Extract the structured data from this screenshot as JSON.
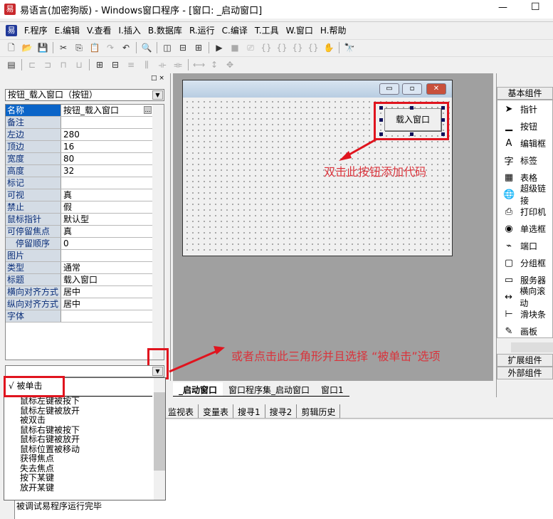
{
  "window": {
    "title": "易语言(加密狗版) - Windows窗口程序 - [窗口: _启动窗口]",
    "min": "—",
    "max": "☐"
  },
  "menu": [
    "F.程序",
    "E.编辑",
    "V.查看",
    "I.插入",
    "B.数据库",
    "R.运行",
    "C.编译",
    "T.工具",
    "W.窗口",
    "H.帮助"
  ],
  "properties": {
    "selector": "按钮_载入窗口（按钮）",
    "rows": [
      [
        "名称",
        "按钮_载入窗口"
      ],
      [
        "备注",
        ""
      ],
      [
        "左边",
        "280"
      ],
      [
        "顶边",
        "16"
      ],
      [
        "宽度",
        "80"
      ],
      [
        "高度",
        "32"
      ],
      [
        "标记",
        ""
      ],
      [
        "可视",
        "真"
      ],
      [
        "禁止",
        "假"
      ],
      [
        "鼠标指针",
        "默认型"
      ],
      [
        "可停留焦点",
        "真"
      ],
      [
        "　停留顺序",
        "0"
      ],
      [
        "图片",
        ""
      ],
      [
        "类型",
        "通常"
      ],
      [
        "标题",
        "载入窗口"
      ],
      [
        "横向对齐方式",
        "居中"
      ],
      [
        "纵向对齐方式",
        "居中"
      ],
      [
        "字体",
        ""
      ]
    ],
    "event_value": ""
  },
  "designer": {
    "button_label": "载入窗口"
  },
  "annotations": {
    "double_click": "双击此按钮添加代码",
    "dropdown_hint": "或者点击此三角形并且选择 “被单击”选项"
  },
  "events": {
    "selected": "√ 被单击",
    "items": [
      "鼠标左键被按下",
      "鼠标左键被放开",
      "被双击",
      "鼠标右键被按下",
      "鼠标右键被放开",
      "鼠标位置被移动",
      "获得焦点",
      "失去焦点",
      "按下某键",
      "放开某键"
    ]
  },
  "tabs": [
    "_启动窗口",
    "窗口程序集_启动窗口",
    "窗口1"
  ],
  "bottom_tabs": [
    "监视表",
    "变量表",
    "搜寻1",
    "搜寻2",
    "剪辑历史"
  ],
  "output": "被调试易程序运行完毕",
  "components": {
    "basic": "基本组件",
    "extended": "扩展组件",
    "external": "外部组件",
    "tools": [
      [
        "pointer-icon",
        "➤",
        "指针"
      ],
      [
        "button-icon",
        "▁",
        "按钮"
      ],
      [
        "editbox-icon",
        "A",
        "编辑框"
      ],
      [
        "label-icon",
        "字",
        "标签"
      ],
      [
        "table-icon",
        "▦",
        "表格"
      ],
      [
        "hyperlink-icon",
        "🌐",
        "超级链接"
      ],
      [
        "printer-icon",
        "⎙",
        "打印机"
      ],
      [
        "radio-icon",
        "◉",
        "单选框"
      ],
      [
        "port-icon",
        "⌁",
        "端口"
      ],
      [
        "groupbox-icon",
        "▢",
        "分组框"
      ],
      [
        "server-icon",
        "▭",
        "服务器"
      ],
      [
        "hscroll-icon",
        "↔",
        "横向滚动"
      ],
      [
        "slider-icon",
        "⊢",
        "滑块条"
      ],
      [
        "canvas-icon",
        "✎",
        "画板"
      ]
    ]
  },
  "colors": {
    "accent": "#0a64c8",
    "annotation": "#e0141e"
  }
}
